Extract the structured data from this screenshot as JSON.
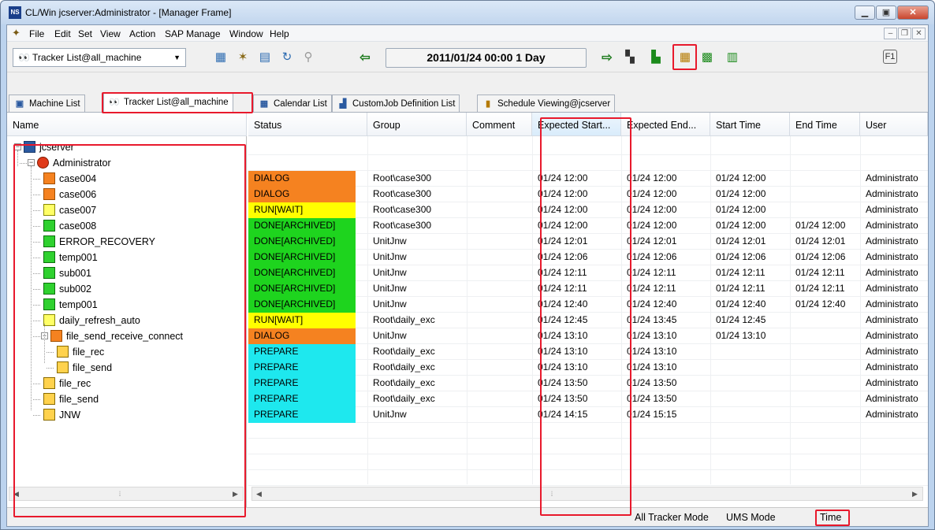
{
  "window": {
    "title": "CL/Win jcserver:Administrator - [Manager Frame]",
    "icon_text": "NS"
  },
  "menu": [
    "File",
    "Edit",
    "Set",
    "View",
    "Action",
    "SAP Manage",
    "Window",
    "Help"
  ],
  "toolbar": {
    "tracker_select": "Tracker List@all_machine",
    "date_range": "2011/01/24 00:00  1 Day",
    "help_label": "F1"
  },
  "tabs": [
    {
      "label": "Machine List",
      "icon": "machine-icon"
    },
    {
      "label": "Tracker List@all_machine",
      "icon": "tracker-icon"
    },
    {
      "label": "Calendar List",
      "icon": "calendar-icon"
    },
    {
      "label": "CustomJob Definition List",
      "icon": "customjob-icon"
    },
    {
      "label": "Schedule Viewing@jcserver",
      "icon": "schedule-icon"
    }
  ],
  "tree": {
    "header": "Name",
    "root": "jcserver",
    "user": "Administrator",
    "group_node": "file_send_receive_connect"
  },
  "columns": [
    "Status",
    "Group",
    "Comment",
    "Expected Start...",
    "Expected End...",
    "Start Time",
    "End Time",
    "User"
  ],
  "status_colors": {
    "DIALOG": "#f58220",
    "RUN[WAIT]": "#ffff00",
    "DONE[ARCHIVED]": "#1ed41e",
    "PREPARE": "#1ee8ee"
  },
  "rows": [
    {
      "name": "case004",
      "icon": "dialog-job-icon",
      "status": "DIALOG",
      "group": "Root\\case300",
      "comment": "",
      "exp_start": "01/24 12:00",
      "exp_end": "01/24 12:00",
      "start": "01/24 12:00",
      "end": "",
      "user": "Administrato"
    },
    {
      "name": "case006",
      "icon": "dialog-job-icon",
      "status": "DIALOG",
      "group": "Root\\case300",
      "comment": "",
      "exp_start": "01/24 12:00",
      "exp_end": "01/24 12:00",
      "start": "01/24 12:00",
      "end": "",
      "user": "Administrato"
    },
    {
      "name": "case007",
      "icon": "run-job-icon",
      "status": "RUN[WAIT]",
      "group": "Root\\case300",
      "comment": "",
      "exp_start": "01/24 12:00",
      "exp_end": "01/24 12:00",
      "start": "01/24 12:00",
      "end": "",
      "user": "Administrato"
    },
    {
      "name": "case008",
      "icon": "done-job-icon",
      "status": "DONE[ARCHIVED]",
      "group": "Root\\case300",
      "comment": "",
      "exp_start": "01/24 12:00",
      "exp_end": "01/24 12:00",
      "start": "01/24 12:00",
      "end": "01/24 12:00",
      "user": "Administrato"
    },
    {
      "name": "ERROR_RECOVERY",
      "icon": "done-job-icon",
      "status": "DONE[ARCHIVED]",
      "group": "UnitJnw",
      "comment": "",
      "exp_start": "01/24 12:01",
      "exp_end": "01/24 12:01",
      "start": "01/24 12:01",
      "end": "01/24 12:01",
      "user": "Administrato"
    },
    {
      "name": "temp001",
      "icon": "done-job-icon",
      "status": "DONE[ARCHIVED]",
      "group": "UnitJnw",
      "comment": "",
      "exp_start": "01/24 12:06",
      "exp_end": "01/24 12:06",
      "start": "01/24 12:06",
      "end": "01/24 12:06",
      "user": "Administrato"
    },
    {
      "name": "sub001",
      "icon": "done-job-icon",
      "status": "DONE[ARCHIVED]",
      "group": "UnitJnw",
      "comment": "",
      "exp_start": "01/24 12:11",
      "exp_end": "01/24 12:11",
      "start": "01/24 12:11",
      "end": "01/24 12:11",
      "user": "Administrato"
    },
    {
      "name": "sub002",
      "icon": "done-job-icon",
      "status": "DONE[ARCHIVED]",
      "group": "UnitJnw",
      "comment": "",
      "exp_start": "01/24 12:11",
      "exp_end": "01/24 12:11",
      "start": "01/24 12:11",
      "end": "01/24 12:11",
      "user": "Administrato"
    },
    {
      "name": "temp001",
      "icon": "done-job-icon",
      "status": "DONE[ARCHIVED]",
      "group": "UnitJnw",
      "comment": "",
      "exp_start": "01/24 12:40",
      "exp_end": "01/24 12:40",
      "start": "01/24 12:40",
      "end": "01/24 12:40",
      "user": "Administrato"
    },
    {
      "name": "daily_refresh_auto",
      "icon": "run-job-icon",
      "status": "RUN[WAIT]",
      "group": "Root\\daily_exc",
      "comment": "",
      "exp_start": "01/24 12:45",
      "exp_end": "01/24 13:45",
      "start": "01/24 12:45",
      "end": "",
      "user": "Administrato"
    },
    {
      "name": "file_send_receive_connect",
      "icon": "dialog-job-icon",
      "status": "DIALOG",
      "group": "UnitJnw",
      "comment": "",
      "exp_start": "01/24 13:10",
      "exp_end": "01/24 13:10",
      "start": "01/24 13:10",
      "end": "",
      "user": "Administrato"
    },
    {
      "name": "file_rec",
      "icon": "prepare-job-icon",
      "status": "PREPARE",
      "group": "Root\\daily_exc",
      "comment": "",
      "exp_start": "01/24 13:10",
      "exp_end": "01/24 13:10",
      "start": "",
      "end": "",
      "user": "Administrato"
    },
    {
      "name": "file_send",
      "icon": "prepare-job-icon",
      "status": "PREPARE",
      "group": "Root\\daily_exc",
      "comment": "",
      "exp_start": "01/24 13:10",
      "exp_end": "01/24 13:10",
      "start": "",
      "end": "",
      "user": "Administrato"
    },
    {
      "name": "file_rec",
      "icon": "prepare-job-icon",
      "status": "PREPARE",
      "group": "Root\\daily_exc",
      "comment": "",
      "exp_start": "01/24 13:50",
      "exp_end": "01/24 13:50",
      "start": "",
      "end": "",
      "user": "Administrato"
    },
    {
      "name": "file_send",
      "icon": "prepare-job-icon",
      "status": "PREPARE",
      "group": "Root\\daily_exc",
      "comment": "",
      "exp_start": "01/24 13:50",
      "exp_end": "01/24 13:50",
      "start": "",
      "end": "",
      "user": "Administrato"
    },
    {
      "name": "JNW",
      "icon": "prepare-job-icon",
      "status": "PREPARE",
      "group": "UnitJnw",
      "comment": "",
      "exp_start": "01/24 14:15",
      "exp_end": "01/24 15:15",
      "start": "",
      "end": "",
      "user": "Administrato"
    }
  ],
  "status_bar": [
    "All Tracker Mode",
    "UMS Mode",
    "Time"
  ]
}
